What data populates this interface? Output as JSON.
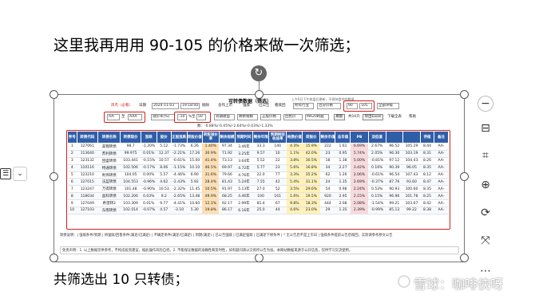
{
  "doc": {
    "heading": "这里我再用用 90-105 的价格来做一次筛选；",
    "footer_text": "共筛选出 10 只转债；"
  },
  "watermark": {
    "text": "雪球：咖啡侠呀"
  },
  "screenshot": {
    "title": "可转债数据（筛选）",
    "note": "上午6日下午收盘后更新，不保持盘中的数据",
    "toolbar1": {
      "link_text": "风杰（必看）",
      "date_label": "日期",
      "date_value": "2024-11-03",
      "time_value": "19:18:00",
      "check1": "剔除",
      "check2": "含作上市",
      "check3": "强赎",
      "check4": "已公告",
      "check5": "看赎回",
      "industry_value": "所有行业",
      "price_label": "百分价格",
      "price_min": "90",
      "price_max": "105",
      "rating_value": "全部评级"
    },
    "toolbar2": {
      "rating_from": "AA-",
      "rating_to_label": "至",
      "rating_to": "AAA",
      "premium_label": "溢价率(%)",
      "premium_min": "-10",
      "premium_to_label": "%至",
      "premium_max": "50",
      "sort1": "到期收益",
      "sort2": "剩余规模",
      "sort3": "正股价格",
      "sort4": "回售价",
      "sort5": "MA20跨越",
      "refresh_button": "刷新",
      "count_text": "共10只",
      "export_button": "导出Excel",
      "download_button": "下载全表",
      "help": "帮助"
    },
    "stats_line": "数：-0.88%/-0.05%/-2.64%/-0.03%/-1.33%",
    "table": {
      "headers": [
        "序号",
        "转债代码",
        "转债名称",
        "转债现价",
        "涨跌",
        "股价",
        "正股涨跌",
        "转股价值",
        "转股溢价率",
        "剩余规模",
        "到期时间",
        "剩余年限",
        "到期税前收益率",
        "纯债价值",
        "转股价",
        "剩余市值",
        "总市值",
        "PB",
        "双低值",
        "评级",
        "备注"
      ],
      "rows": [
        [
          "1",
          "127061",
          "美锦转债",
          "98.7",
          "-1.20%",
          "5.12",
          "-1.73%",
          "6.26",
          "1.40%",
          "97.34",
          "3.46年",
          "33.3",
          "140",
          "4.3%",
          "15.9%",
          "222",
          "1.61",
          "6.69%",
          "2.67%",
          "96.52",
          "105.29",
          "8.44",
          "AA-"
        ],
        [
          "2",
          "113640",
          "苏利转债",
          "99.975",
          "0.01%",
          "12.37",
          "-2.21%",
          "17.26",
          "30.9%",
          "71.92",
          "3.25年",
          "9.57",
          "10",
          "1.1%",
          "42.0%",
          "23",
          "0.95",
          "5.74%",
          "2.05%",
          "96.30",
          "103.19",
          "8.31",
          "AA-"
        ],
        [
          "3",
          "123132",
          "回盛转债",
          "103.441",
          "-0.15%",
          "10.57",
          "-0.61%",
          "15.00",
          "41.4%",
          "73.13",
          "3.64年",
          "5.52",
          "22",
          "3.8%",
          "30.5%",
          "18",
          "1.38",
          "5.00%",
          "-0.81%",
          "97.12",
          "104.43",
          "8.26",
          "AA-"
        ],
        [
          "4",
          "110116",
          "特通转债",
          "102.506",
          "-0.17%",
          "8.06",
          "-1.15%",
          "10.10",
          "46.5%",
          "69.97",
          "4.72年",
          "5.77",
          "23",
          "5.6%",
          "16.8%",
          "34",
          "2.27",
          "3.42%",
          "0.16%",
          "90.39",
          "96.05",
          "8.35",
          "AA-"
        ],
        [
          "5",
          "123210",
          "利伟转债",
          "104.05",
          "0.00%",
          "5.57",
          "-4.46%",
          "6.90",
          "31.6%",
          "79.66",
          "4.76年",
          "22.0",
          "77",
          "3.3%",
          "35.2%",
          "62",
          "1.26",
          "2.06%",
          "-0.61%",
          "96.54",
          "107.43",
          "8.12",
          "AA-"
        ],
        [
          "6",
          "127015",
          "法蓝转债",
          "104.553",
          "-0.96%",
          "4.62",
          "-2.43%",
          "5.92",
          "28.4%",
          "81.43",
          "5.24年",
          "7.55",
          "42",
          "5.4%",
          "31.1%",
          "24",
          "1.35",
          "2.69%",
          "-0.37%",
          "87.76",
          "93.60",
          "8.47",
          "AA-"
        ],
        [
          "7",
          "123247",
          "万得转债",
          "101.48",
          "-0.90%",
          "10.53",
          "-2.32%",
          "11.45",
          "10.5%",
          "91.97",
          "5.13年",
          "27.0",
          "52",
          "3.5%",
          "29.6%",
          "54",
          "0.98",
          "2.24%",
          "0.53%",
          "90.93",
          "100.60",
          "8.35",
          "AA-"
        ],
        [
          "8",
          "118034",
          "晶科转债",
          "102.206",
          "0.03%",
          "9.2",
          "-2.65%",
          "13.48",
          "49.9%",
          "68.25",
          "4.46年",
          "100",
          "161",
          "1.6%",
          "19.5%",
          "920",
          "2.95",
          "2.15%",
          "0.15%",
          "96.96",
          "101.78",
          "8.25",
          "AA-"
        ],
        [
          "9",
          "127049",
          "希望转2",
          "103.309",
          "0.01%",
          "9.77",
          "-4.41%",
          "10.60",
          "12.1%",
          "92.17",
          "2.99年",
          "81.4",
          "67",
          "9.8%",
          "18.3%",
          "444",
          "2.08",
          "2.08%",
          "-1.54%",
          "99.21",
          "103.67",
          "8.42",
          "AA-"
        ],
        [
          "10",
          "127103",
          "东南转债",
          "102.014",
          "-0.07%",
          "4.57",
          "-3.10",
          "5.30",
          "19.8%",
          "86.17",
          "6.16年",
          "25.0",
          "44",
          "4.6%",
          "23.0%",
          "29",
          "1.35",
          "2.39%",
          "-0.99%",
          "85.13",
          "99.22",
          "8.38",
          "AA-"
        ]
      ]
    },
    "legend_text": "转债说明：| 强赎条件/到期 | 将强赎/回售条件(满足/已满足) | 不确定条件(满足/已满足) | 到期(满足) | 已公告强赎 | 已满足强赎 | 已满足下修条件 | * 无公告后不是上市日 | 强赎条件提前公告后赎回，实际请参考原文公告",
    "disclaimer_text": "免责声明：1. 以上数据仅供参考，不构成投资建议，据此操作风险自担。2. 不能保证数据的准确性和及时性，如有疑问请以交易所公告为准。本网站数据来源于公开信息，仅供学习交流使用。"
  }
}
